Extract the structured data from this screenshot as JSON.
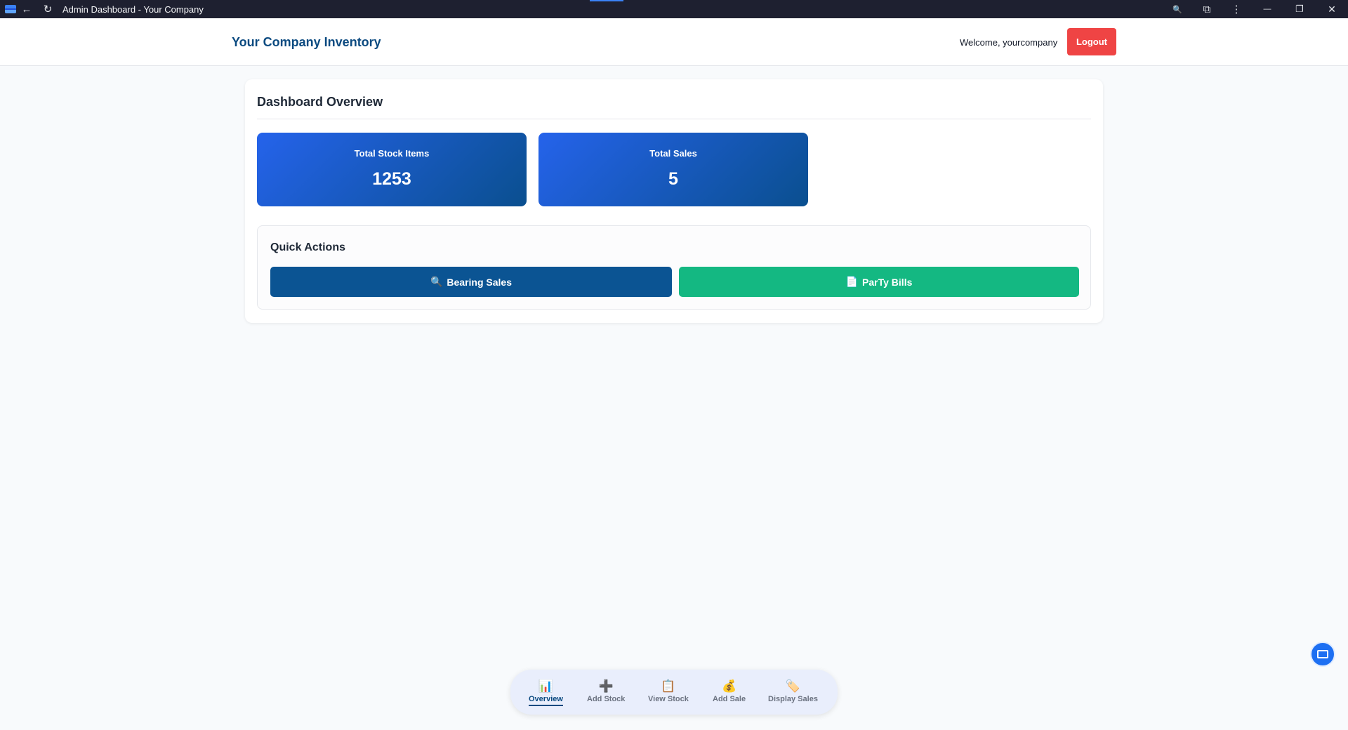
{
  "window": {
    "title": "Admin Dashboard - Your Company",
    "back_icon": "←",
    "reload_icon": "↻",
    "zoom_icon": "🔍",
    "extension_icon": "⧉",
    "menu_icon": "⋮",
    "minimize_icon": "—",
    "restore_icon": "❐",
    "close_icon": "✕"
  },
  "header": {
    "brand": "Your Company Inventory",
    "welcome": "Welcome, yourcompany",
    "logout_label": "Logout"
  },
  "dashboard": {
    "title": "Dashboard Overview",
    "stats": [
      {
        "label": "Total Stock Items",
        "value": "1253"
      },
      {
        "label": "Total Sales",
        "value": "5"
      }
    ],
    "quick_actions": {
      "title": "Quick Actions",
      "buttons": [
        {
          "icon": "🔍",
          "label": "Bearing Sales",
          "color": "#0b5493"
        },
        {
          "icon": "📄",
          "label": "ParTy Bills",
          "color": "#14b882"
        }
      ]
    }
  },
  "bottom_nav": {
    "items": [
      {
        "icon": "📊",
        "label": "Overview",
        "active": true
      },
      {
        "icon": "➕",
        "label": "Add Stock",
        "active": false
      },
      {
        "icon": "📋",
        "label": "View Stock",
        "active": false
      },
      {
        "icon": "💰",
        "label": "Add Sale",
        "active": false
      },
      {
        "icon": "🏷️",
        "label": "Display Sales",
        "active": false
      }
    ]
  },
  "colors": {
    "brand": "#0b4a80",
    "logout": "#ef4444",
    "stat_gradient_start": "#2563eb",
    "stat_gradient_end": "#0a4f8f"
  }
}
